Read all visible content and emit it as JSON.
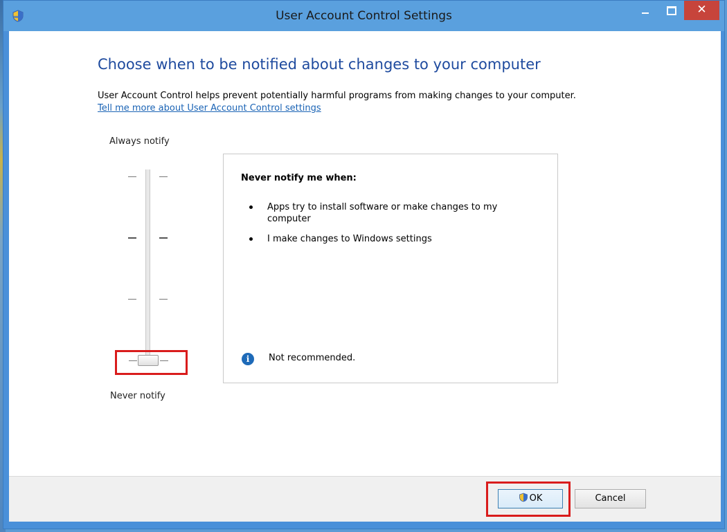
{
  "window": {
    "title": "User Account Control Settings",
    "close_glyph": "✕"
  },
  "main": {
    "heading": "Choose when to be notified about changes to your computer",
    "description": "User Account Control helps prevent potentially harmful programs from making changes to your computer.",
    "help_link": "Tell me more about User Account Control settings"
  },
  "slider": {
    "top_label": "Always notify",
    "bottom_label": "Never notify",
    "levels": 4,
    "selected_level": 1
  },
  "panel": {
    "heading": "Never notify me when:",
    "bullets": [
      "Apps try to install software or make changes to my computer",
      "I make changes to Windows settings"
    ],
    "info_text": "Not recommended.",
    "info_icon": "info-icon"
  },
  "buttons": {
    "ok_label": "OK",
    "cancel_label": "Cancel"
  },
  "colors": {
    "titlebar": "#5aa0de",
    "close_button": "#c7443b",
    "heading_text": "#1e4a9e",
    "link": "#1a63b5",
    "highlight": "#d91c1c"
  }
}
